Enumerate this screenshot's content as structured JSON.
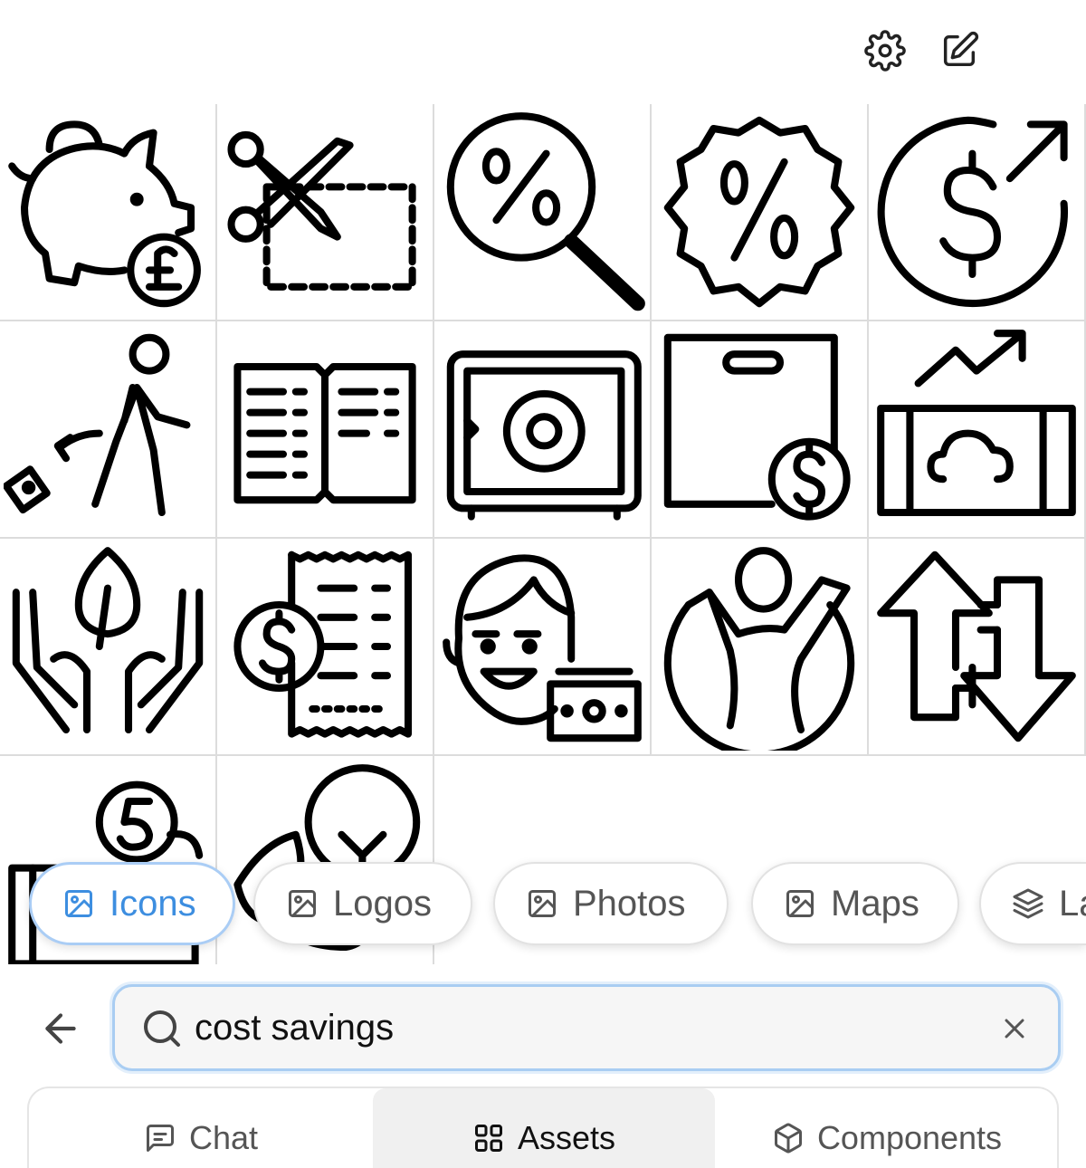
{
  "toolbar": {
    "settings_icon": "gear-icon",
    "edit_icon": "edit-square-icon"
  },
  "results": [
    {
      "name": "piggy-bank-pound-icon"
    },
    {
      "name": "scissors-coupon-icon"
    },
    {
      "name": "magnifier-percent-icon"
    },
    {
      "name": "discount-badge-percent-icon"
    },
    {
      "name": "dollar-growth-arrow-icon"
    },
    {
      "name": "walking-person-drop-icon"
    },
    {
      "name": "ledger-book-icon"
    },
    {
      "name": "safe-vault-icon"
    },
    {
      "name": "bag-dollar-icon"
    },
    {
      "name": "cloud-growth-chart-icon"
    },
    {
      "name": "hands-leaf-icon"
    },
    {
      "name": "receipt-dollar-icon"
    },
    {
      "name": "happy-person-cash-icon"
    },
    {
      "name": "person-circle-arms-up-icon"
    },
    {
      "name": "up-down-arrows-icon"
    },
    {
      "name": "coin-five-wallet-icon"
    },
    {
      "name": "lightbulb-leaves-icon"
    }
  ],
  "asset_types": [
    {
      "label": "Icons",
      "active": true
    },
    {
      "label": "Logos",
      "active": false
    },
    {
      "label": "Photos",
      "active": false
    },
    {
      "label": "Maps",
      "active": false
    },
    {
      "label": "La",
      "active": false
    }
  ],
  "search": {
    "value": "cost savings"
  },
  "tabs": [
    {
      "label": "Chat",
      "active": false
    },
    {
      "label": "Assets",
      "active": true
    },
    {
      "label": "Components",
      "active": false
    }
  ],
  "colors": {
    "accent": "#3d8ee0",
    "focus_ring": "#a9cdf2",
    "grid_line": "#dcdcdc"
  }
}
